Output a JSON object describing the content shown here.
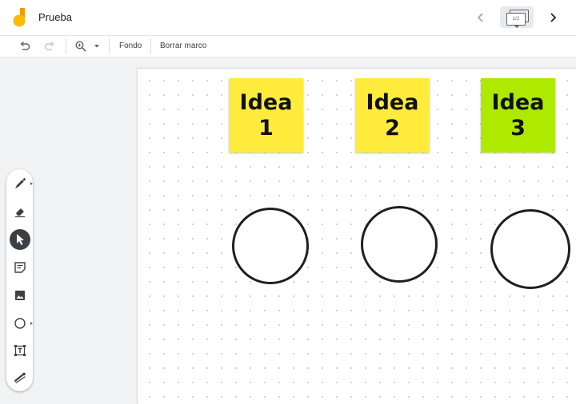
{
  "header": {
    "title": "Prueba",
    "frame_counter": "1/2",
    "logo_colors": {
      "yellow": "#fbbc04",
      "orange": "#f29900"
    }
  },
  "icons": {
    "app_logo": "jamboard-logo-icon",
    "prev": "chevron-left-icon",
    "next": "chevron-right-icon",
    "frames": "frames-stack-icon",
    "undo": "undo-icon",
    "redo": "redo-icon",
    "zoom": "zoom-in-icon",
    "zoom_dropdown": "caret-down-icon"
  },
  "toolbar": {
    "background_label": "Fondo",
    "clear_frame_label": "Borrar marco"
  },
  "notes": [
    {
      "line1": "Idea",
      "line2": "1",
      "color": "#ffeb3b"
    },
    {
      "line1": "Idea",
      "line2": "2",
      "color": "#ffeb3b"
    },
    {
      "line1": "Idea",
      "line2": "3",
      "color": "#aeea00"
    }
  ],
  "shapes": [
    "circle",
    "circle",
    "circle"
  ],
  "tools": [
    {
      "name": "pen",
      "icon": "pen-icon",
      "active": false
    },
    {
      "name": "eraser",
      "icon": "eraser-icon",
      "active": false
    },
    {
      "name": "select",
      "icon": "cursor-arrow-icon",
      "active": true
    },
    {
      "name": "sticky-note",
      "icon": "sticky-note-icon",
      "active": false
    },
    {
      "name": "image",
      "icon": "image-icon",
      "active": false
    },
    {
      "name": "shape",
      "icon": "circle-shape-icon",
      "active": false
    },
    {
      "name": "text-box",
      "icon": "text-box-icon",
      "active": false
    },
    {
      "name": "laser",
      "icon": "laser-pointer-icon",
      "active": false
    }
  ],
  "colors": {
    "active_tool": "#3c4043",
    "canvas": "#ffffff",
    "workspace": "#f1f3f4"
  }
}
